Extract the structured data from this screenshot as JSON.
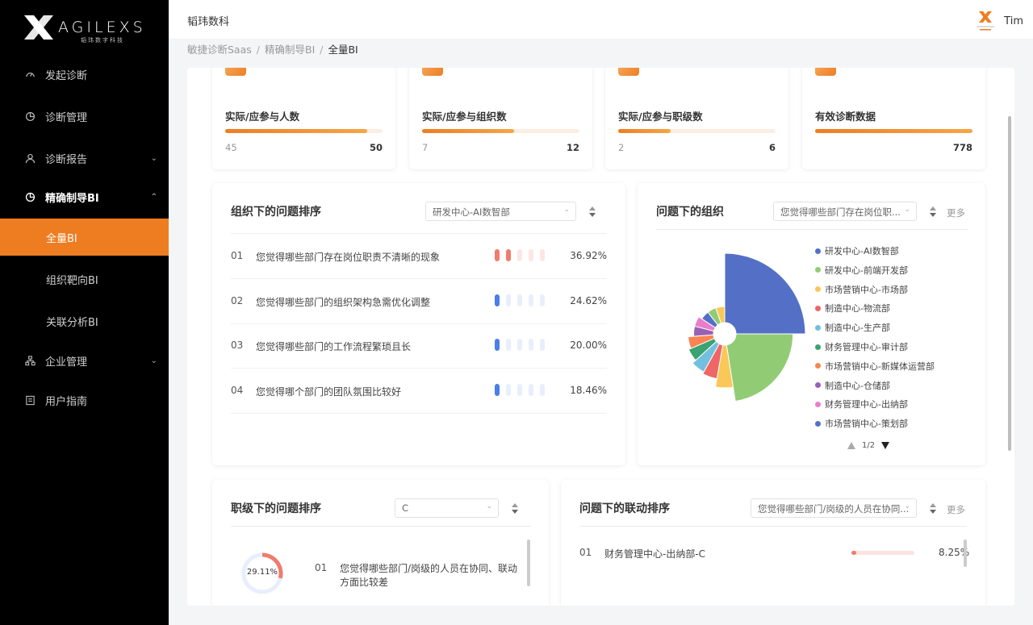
{
  "brand": {
    "word": "AGILEXS",
    "sub": "韬玮数字科技"
  },
  "sidebar": {
    "items": [
      {
        "label": "发起诊断",
        "icon": "dashboard-icon"
      },
      {
        "label": "诊断管理",
        "icon": "pie-icon"
      },
      {
        "label": "诊断报告",
        "icon": "user-icon"
      },
      {
        "label": "精确制导BI",
        "icon": "pie-icon"
      },
      {
        "label": "企业管理",
        "icon": "org-icon"
      },
      {
        "label": "用户指南",
        "icon": "book-icon"
      }
    ],
    "sub_items": [
      {
        "label": "全量BI",
        "active": true
      },
      {
        "label": "组织靶向BI",
        "active": false
      },
      {
        "label": "关联分析BI",
        "active": false
      }
    ]
  },
  "topbar": {
    "company": "韬玮数科",
    "user_name": "Tim"
  },
  "breadcrumb": {
    "items": [
      "敏捷诊断Saas",
      "精确制导BI",
      "全量BI"
    ]
  },
  "stats": [
    {
      "title": "实际/应参与人数",
      "actual": "45",
      "target": "50",
      "progress": 0.9
    },
    {
      "title": "实际/应参与组织数",
      "actual": "7",
      "target": "12",
      "progress": 0.583
    },
    {
      "title": "实际/应参与职级数",
      "actual": "2",
      "target": "6",
      "progress": 0.333
    },
    {
      "title": "有效诊断数据",
      "actual": "",
      "target": "778",
      "progress": 1.0
    }
  ],
  "org_ranking": {
    "title": "组织下的问题排序",
    "select_value": "研发中心-AI数智部",
    "rows": [
      {
        "no": "01",
        "text": "您觉得哪些部门存在岗位职责不清晰的现象",
        "pct": "36.92%",
        "level": 2,
        "color": "#f07c6c"
      },
      {
        "no": "02",
        "text": "您觉得哪些部门的组织架构急需优化调整",
        "pct": "24.62%",
        "level": 1,
        "color": "#4a7ee8"
      },
      {
        "no": "03",
        "text": "您觉得哪些部门的工作流程繁琐且长",
        "pct": "20.00%",
        "level": 1,
        "color": "#4a7ee8"
      },
      {
        "no": "04",
        "text": "您觉得哪个部门的团队氛围比较好",
        "pct": "18.46%",
        "level": 1,
        "color": "#4a7ee8"
      }
    ]
  },
  "problem_org": {
    "title": "问题下的组织",
    "select_value": "您觉得哪些部门存在岗位职...",
    "more": "更多",
    "pager": "1/2",
    "legend": [
      {
        "name": "研发中心-AI数智部",
        "color": "#5470c6"
      },
      {
        "name": "研发中心-前端开发部",
        "color": "#91cc75"
      },
      {
        "name": "市场营销中心-市场部",
        "color": "#fac858"
      },
      {
        "name": "制造中心-物流部",
        "color": "#ee6666"
      },
      {
        "name": "制造中心-生产部",
        "color": "#73c0de"
      },
      {
        "name": "财务管理中心-审计部",
        "color": "#3ba272"
      },
      {
        "name": "市场营销中心-新媒体运营部",
        "color": "#fc8452"
      },
      {
        "name": "制造中心-仓储部",
        "color": "#9a60b4"
      },
      {
        "name": "财务管理中心-出纳部",
        "color": "#ea7ccc"
      },
      {
        "name": "市场营销中心-策划部",
        "color": "#5470c6"
      }
    ]
  },
  "chart_data": {
    "type": "pie",
    "variant": "rose",
    "series": [
      {
        "name": "研发中心-AI数智部",
        "value": 37
      },
      {
        "name": "研发中心-前端开发部",
        "value": 25
      },
      {
        "name": "市场营销中心-市场部",
        "value": 14
      },
      {
        "name": "制造中心-物流部",
        "value": 9
      },
      {
        "name": "制造中心-生产部",
        "value": 8
      },
      {
        "name": "财务管理中心-审计部",
        "value": 6
      },
      {
        "name": "市场营销中心-新媒体运营部",
        "value": 5
      },
      {
        "name": "制造中心-仓储部",
        "value": 3
      },
      {
        "name": "财务管理中心-出纳部",
        "value": 3
      },
      {
        "name": "市场营销中心-策划部",
        "value": 2
      },
      {
        "name": "",
        "value": 2
      },
      {
        "name": "",
        "value": 2
      }
    ],
    "extra_colors": [
      "#91cc75",
      "#fac858"
    ]
  },
  "level_ranking": {
    "title": "职级下的问题排序",
    "select_value": "C",
    "donut_pct": "29.11%",
    "donut_value": 0.2911,
    "row": {
      "no": "01",
      "text": "您觉得哪些部门/岗级的人员在协同、联动方面比较差"
    }
  },
  "linkage_ranking": {
    "title": "问题下的联动排序",
    "select_value": "您觉得哪些部门/岗级的人员在协同...",
    "more": "更多",
    "row": {
      "no": "01",
      "text": "财务管理中心-出纳部-C",
      "pct": "8.25%",
      "value": 0.0825
    }
  }
}
